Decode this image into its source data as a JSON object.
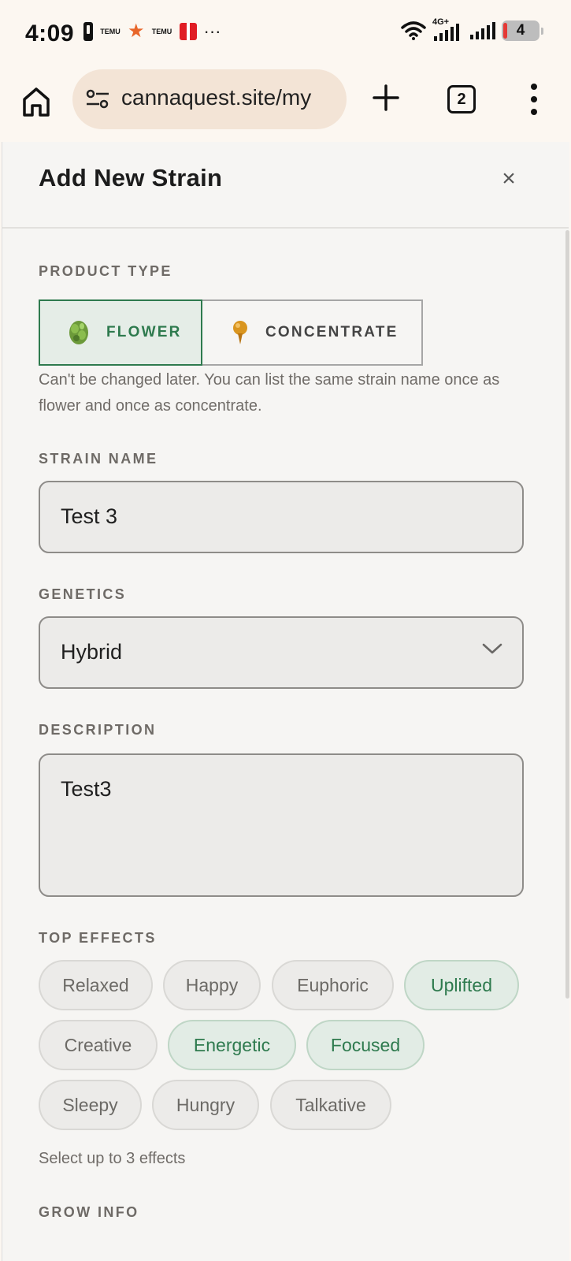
{
  "status_bar": {
    "time": "4:09",
    "temu_label_1": "TEMU",
    "temu_label_2": "TEMU",
    "more_dots": "···",
    "network": "4G+",
    "battery": "4"
  },
  "browser": {
    "url": "cannaquest.site/my",
    "tab_count": "2"
  },
  "modal": {
    "title": "Add New Strain",
    "close_label": "×"
  },
  "product_type": {
    "label": "PRODUCT TYPE",
    "options": [
      "FLOWER",
      "CONCENTRATE"
    ],
    "selected": "FLOWER",
    "hint": "Can't be changed later. You can list the same strain name once as flower and once as concentrate."
  },
  "strain_name": {
    "label": "STRAIN NAME",
    "value": "Test 3"
  },
  "genetics": {
    "label": "GENETICS",
    "value": "Hybrid"
  },
  "description": {
    "label": "DESCRIPTION",
    "value": "Test3"
  },
  "top_effects": {
    "label": "TOP EFFECTS",
    "chips": [
      {
        "label": "Relaxed",
        "selected": false
      },
      {
        "label": "Happy",
        "selected": false
      },
      {
        "label": "Euphoric",
        "selected": false
      },
      {
        "label": "Uplifted",
        "selected": true
      },
      {
        "label": "Creative",
        "selected": false
      },
      {
        "label": "Energetic",
        "selected": true
      },
      {
        "label": "Focused",
        "selected": true
      },
      {
        "label": "Sleepy",
        "selected": false
      },
      {
        "label": "Hungry",
        "selected": false
      },
      {
        "label": "Talkative",
        "selected": false
      }
    ],
    "hint": "Select up to 3 effects"
  },
  "grow_info": {
    "label": "GROW INFO"
  },
  "colors": {
    "accent_green": "#2e7a4e",
    "url_pill": "#f3e4d6"
  }
}
